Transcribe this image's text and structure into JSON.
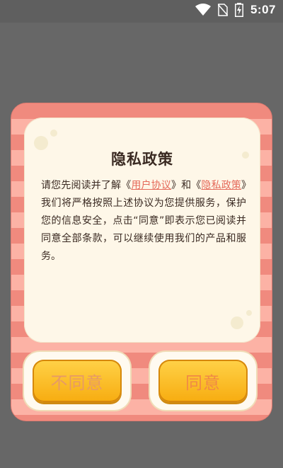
{
  "status_bar": {
    "time": "5:07",
    "icons": [
      "wifi-icon",
      "no-sim-icon",
      "battery-charging-icon"
    ]
  },
  "dialog": {
    "title": "隐私政策",
    "text_before": "请您先阅读并了解《",
    "link_user_agreement": "用户协议",
    "text_between": "》和《",
    "link_privacy_policy": "隐私政策",
    "text_after": "》我们将严格按照上述协议为您提供服务，保护您的信息安全，点击“同意”即表示您已阅读并同意全部条款，可以继续使用我们的产品和服务。",
    "disagree_label": "不同意",
    "agree_label": "同意"
  },
  "colors": {
    "stripe_dark": "#f08a7e",
    "stripe_light": "#fcb2a5",
    "card_bg": "#fef7e8",
    "button_yellow": "#ffd248",
    "link": "#e56a5a"
  }
}
